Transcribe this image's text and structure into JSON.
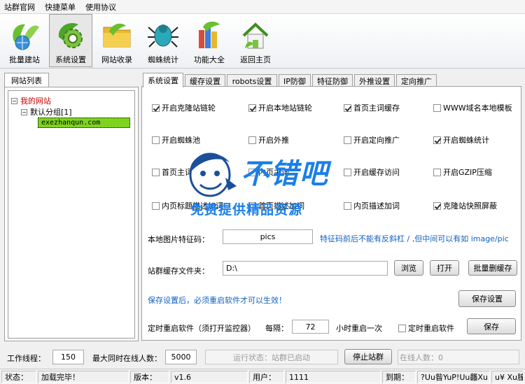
{
  "menu": [
    "站群官网",
    "快捷菜单",
    "使用协议"
  ],
  "toolbar": [
    {
      "label": "批量建站",
      "icon": "leaf-globe-icon"
    },
    {
      "label": "系统设置",
      "icon": "gear-leaf-icon"
    },
    {
      "label": "网站收录",
      "icon": "folder-icon"
    },
    {
      "label": "蜘蛛统计",
      "icon": "spider-icon"
    },
    {
      "label": "功能大全",
      "icon": "books-icon"
    },
    {
      "label": "返回主页",
      "icon": "home-icon"
    }
  ],
  "left_panel": {
    "tab": "网站列表",
    "tree": {
      "root": "我的网站",
      "group": "默认分组[1]",
      "site": "exezhanqun.com"
    }
  },
  "tabs": [
    "系统设置",
    "缓存设置",
    "robots设置",
    "IP防御",
    "特征防御",
    "外推设置",
    "定向推广"
  ],
  "checkboxes": [
    {
      "label": "开启克隆站链轮",
      "checked": true
    },
    {
      "label": "开启本地站链轮",
      "checked": true
    },
    {
      "label": "首页主词缓存",
      "checked": true
    },
    {
      "label": "WWW域名本地模板",
      "checked": false
    },
    {
      "label": "开启蜘蛛池",
      "checked": false
    },
    {
      "label": "开启外推",
      "checked": false
    },
    {
      "label": "开启定向推广",
      "checked": false
    },
    {
      "label": "开启蜘蛛统计",
      "checked": true
    },
    {
      "label": "首页主词",
      "checked": false
    },
    {
      "label": "内页主词",
      "checked": false
    },
    {
      "label": "开启缓存访问",
      "checked": false
    },
    {
      "label": "开启GZIP压缩",
      "checked": false
    },
    {
      "label": "内页标题描述加词",
      "checked": false
    },
    {
      "label": "首页描述加词",
      "checked": false
    },
    {
      "label": "内页描述加词",
      "checked": false
    },
    {
      "label": "克隆站快照屏蔽",
      "checked": true
    }
  ],
  "image_code": {
    "label": "本地图片特征码：",
    "value": "pics",
    "hint": "特征码前后不能有反斜杠 / ,但中间可以有如 image/pic"
  },
  "cache_folder": {
    "label": "站群缓存文件夹：",
    "value": "D:\\",
    "browse": "浏览",
    "open": "打开",
    "batch_delete": "批量删缓存"
  },
  "notice": "保存设置后，必须重启软件才可以生效！",
  "save_settings": "保存设置",
  "restart": {
    "label": "定时重启软件（须打开监控器）",
    "every": "每隔：",
    "hours": "72",
    "unit": "小时重启一次",
    "checkbox": "定时重启软件",
    "save": "保存"
  },
  "watermark": {
    "title": "不错吧",
    "subtitle": "免费提供精品资源"
  },
  "bottom": {
    "threads_label": "工作线程：",
    "threads": "150",
    "max_online_label": "最大同时在线人数：",
    "max_online": "5000",
    "run_status": "运行状态：站群已启动",
    "stop": "停止站群",
    "online": "在线人数：0"
  },
  "status": {
    "state_label": "状态：",
    "state": "加载完毕！",
    "version_label": "版本：",
    "version": "v1.6",
    "user_label": "用户：",
    "user": "1111",
    "expire_label": "到期：",
    "expire": "?Uu昝YuP!Uu龘Xu",
    "extra": "u¥ Xu膧"
  }
}
